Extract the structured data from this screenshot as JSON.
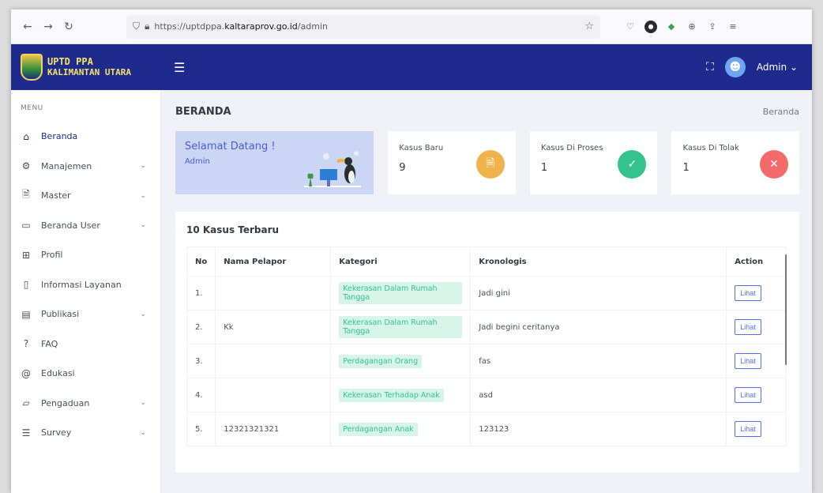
{
  "browser": {
    "url_prefix": "https://uptdppa.",
    "url_host": "kaltaraprov.go.id",
    "url_path": "/admin"
  },
  "header": {
    "logo_line1": "UPTD PPA",
    "logo_line2": "KALIMANTAN UTARA",
    "user_name": "Admin"
  },
  "sidebar": {
    "menu_title": "MENU",
    "items": [
      {
        "label": "Beranda"
      },
      {
        "label": "Manajemen"
      },
      {
        "label": "Master"
      },
      {
        "label": "Beranda User"
      },
      {
        "label": "Profil"
      },
      {
        "label": "Informasi Layanan"
      },
      {
        "label": "Publikasi"
      },
      {
        "label": "FAQ"
      },
      {
        "label": "Edukasi"
      },
      {
        "label": "Pengaduan"
      },
      {
        "label": "Survey"
      }
    ]
  },
  "page": {
    "title": "BERANDA",
    "breadcrumb": "Beranda"
  },
  "welcome": {
    "title": "Selamat Datang !",
    "subtitle": "Admin"
  },
  "stats": [
    {
      "label": "Kasus Baru",
      "value": "9",
      "color": "#f1b44c"
    },
    {
      "label": "Kasus Di Proses",
      "value": "1",
      "color": "#34c38f"
    },
    {
      "label": "Kasus Di Tolak",
      "value": "1",
      "color": "#f46a6a"
    }
  ],
  "table": {
    "title": "10 Kasus Terbaru",
    "headers": [
      "No",
      "Nama Pelapor",
      "Kategori",
      "Kronologis",
      "Action"
    ],
    "action_label": "Lihat",
    "rows": [
      {
        "no": "1.",
        "nama": "",
        "kategori": "Kekerasan Dalam Rumah Tangga",
        "kronologis": "Jadi gini"
      },
      {
        "no": "2.",
        "nama": "Kk",
        "kategori": "Kekerasan Dalam Rumah Tangga",
        "kronologis": "Jadi begini ceritanya"
      },
      {
        "no": "3.",
        "nama": "",
        "kategori": "Perdagangan Orang",
        "kronologis": "fas"
      },
      {
        "no": "4.",
        "nama": "",
        "kategori": "Kekerasan Terhadap Anak",
        "kronologis": "asd"
      },
      {
        "no": "5.",
        "nama": "12321321321",
        "kategori": "Perdagangan Anak",
        "kronologis": "123123"
      }
    ]
  }
}
